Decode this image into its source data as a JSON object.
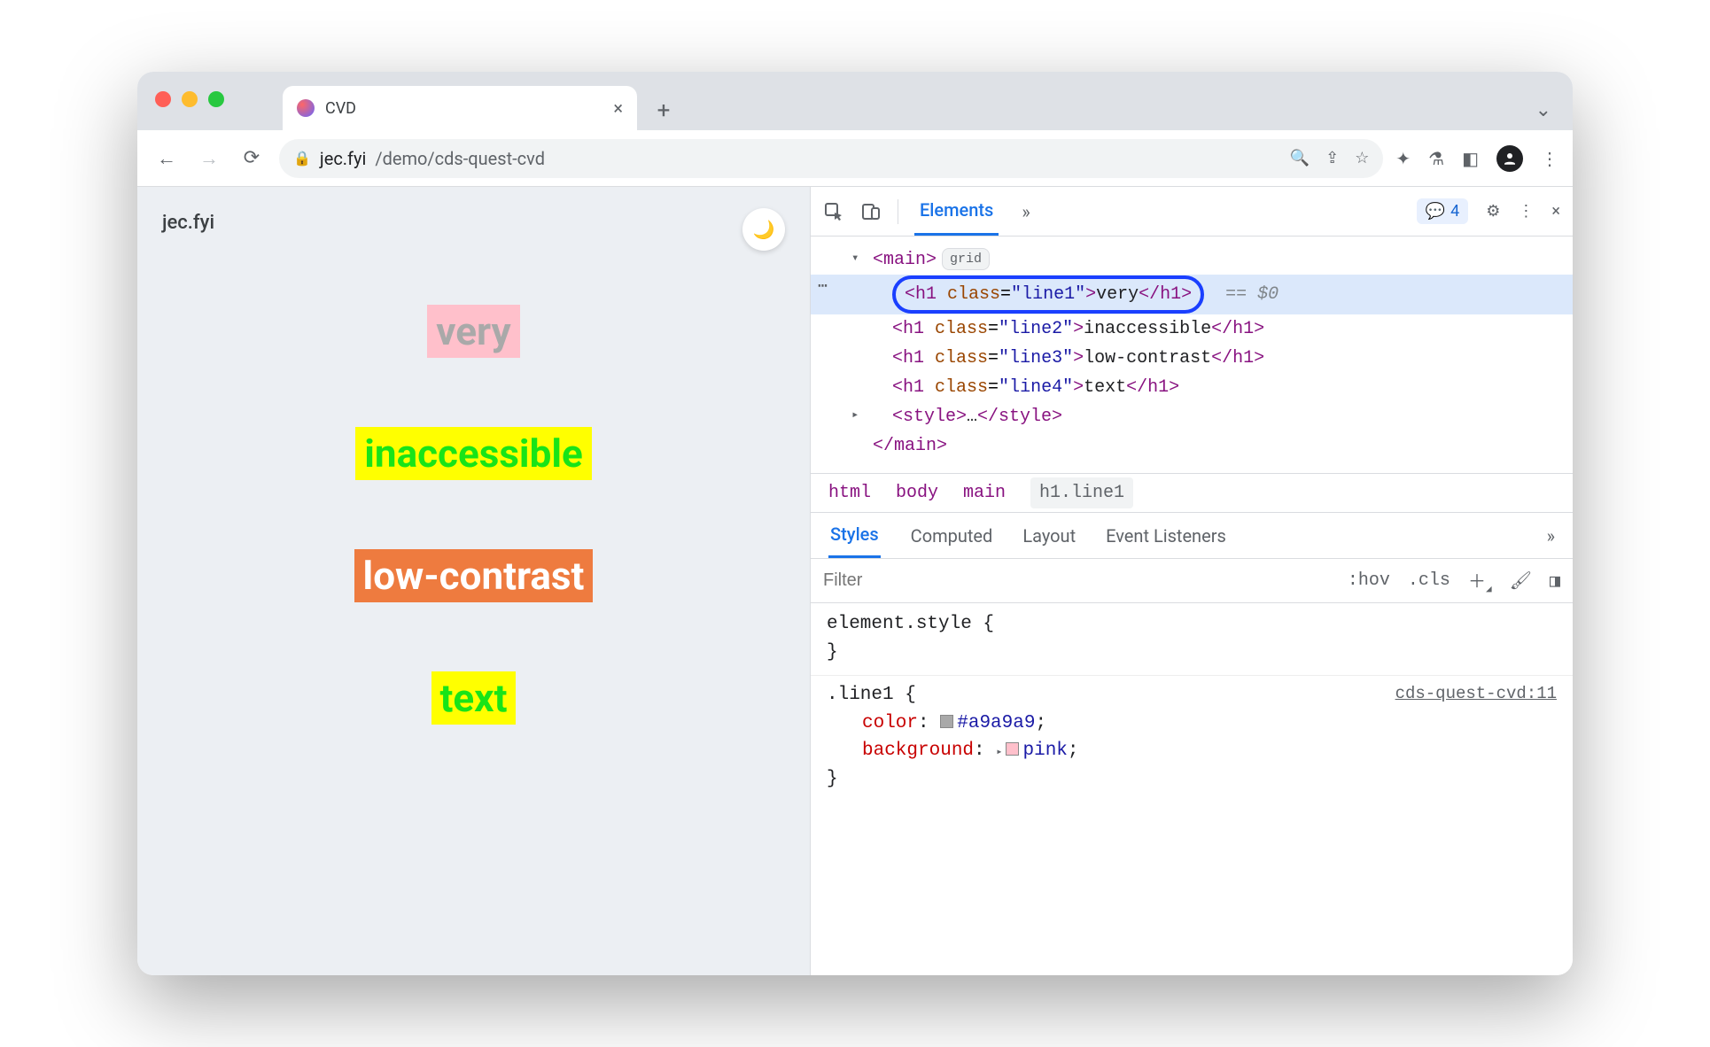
{
  "browser": {
    "tab_title": "CVD",
    "url_domain": "jec.fyi",
    "url_path": "/demo/cds-quest-cvd"
  },
  "page": {
    "site_label": "jec.fyi",
    "lines": {
      "line1": "very",
      "line2": "inaccessible",
      "line3": "low-contrast",
      "line4": "text"
    }
  },
  "devtools": {
    "panel": "Elements",
    "issues_count": "4",
    "dom": {
      "main_tag": "main",
      "main_badge": "grid",
      "h1_1": {
        "class": "line1",
        "text": "very",
        "eqref": "== $0"
      },
      "h1_2": {
        "class": "line2",
        "text": "inaccessible"
      },
      "h1_3": {
        "class": "line3",
        "text": "low-contrast"
      },
      "h1_4": {
        "class": "line4",
        "text": "text"
      },
      "style_collapsed": "…",
      "main_close": "main"
    },
    "breadcrumbs": [
      "html",
      "body",
      "main",
      "h1.line1"
    ],
    "styles_tabs": [
      "Styles",
      "Computed",
      "Layout",
      "Event Listeners"
    ],
    "filter_placeholder": "Filter",
    "actions": {
      "hov": ":hov",
      "cls": ".cls"
    },
    "rules": {
      "element_style_label": "element.style {",
      "element_style_close": "}",
      "line1_selector": ".line1 {",
      "line1_src": "cds-quest-cvd:11",
      "line1_color_name": "color",
      "line1_color_value": "#a9a9a9",
      "line1_bg_name": "background",
      "line1_bg_value": "pink",
      "line1_close": "}"
    }
  }
}
